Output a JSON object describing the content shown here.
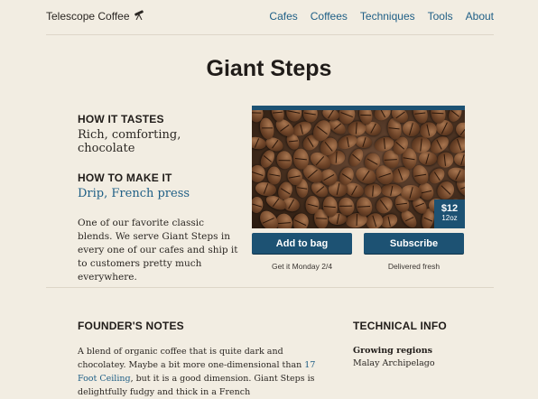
{
  "header": {
    "logo_text": "Telescope Coffee",
    "logo_icon": "telescope-icon",
    "nav": [
      "Cafes",
      "Coffees",
      "Techniques",
      "Tools",
      "About"
    ]
  },
  "product": {
    "title": "Giant Steps",
    "how_it_tastes_heading": "HOW IT TASTES",
    "tastes": "Rich, comforting, chocolate",
    "how_to_make_heading": "HOW TO MAKE IT",
    "methods": [
      "Drip",
      "French press"
    ],
    "description": "One of our favorite classic blends. We serve Giant Steps in every one of our cafes and ship it to customers pretty much everywhere.",
    "price": "$12",
    "size": "12oz",
    "add_to_bag_label": "Add to bag",
    "subscribe_label": "Subscribe",
    "add_note": "Get it Monday 2/4",
    "subscribe_note": "Delivered fresh"
  },
  "founders_notes": {
    "heading": "FOUNDER'S NOTES",
    "text_before_link": "A blend of organic coffee that is quite dark and chocolatey. Maybe a bit more one-dimensional than ",
    "link_text": "17 Foot Ceiling",
    "text_after_link": ", but it is a good dimension. Giant Steps is delightfully fudgy and thick in a French"
  },
  "technical_info": {
    "heading": "TECHNICAL INFO",
    "growing_regions_label": "Growing regions",
    "growing_regions_value": "Malay Archipelago"
  },
  "colors": {
    "accent": "#1d5273",
    "link": "#1f5f86",
    "background": "#f2ede2"
  }
}
